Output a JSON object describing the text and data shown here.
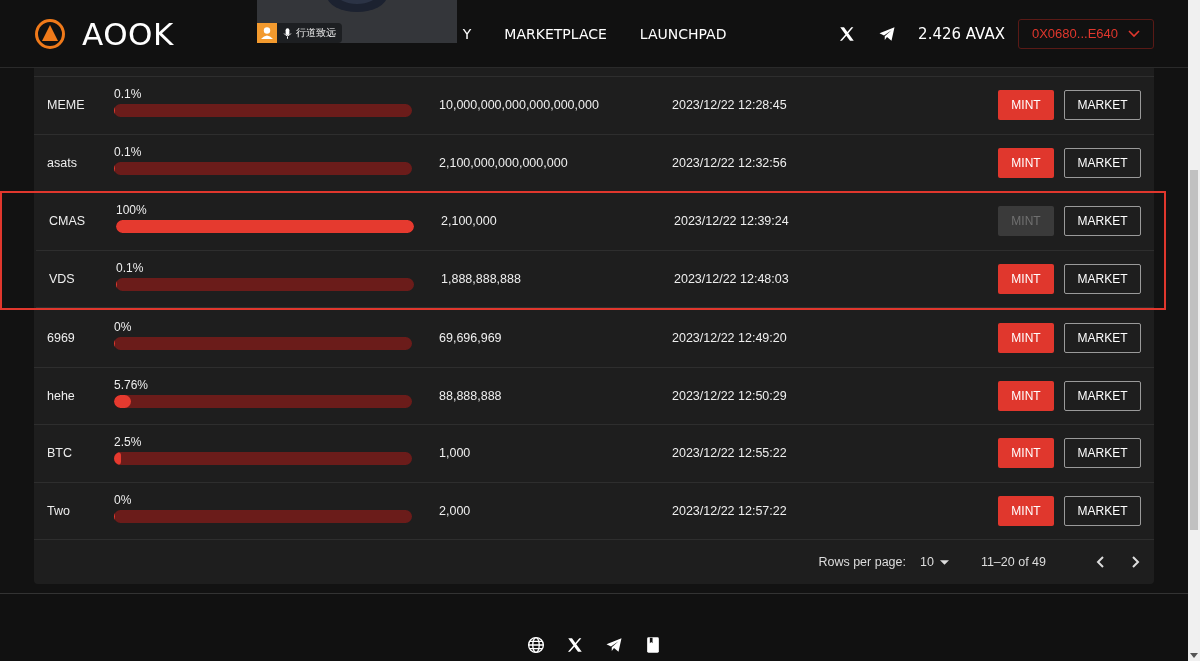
{
  "header": {
    "logo": "AOOK",
    "nav": [
      {
        "label": "Y"
      },
      {
        "label": "MARKETPLACE"
      },
      {
        "label": "LAUNCHPAD"
      }
    ],
    "balance": "2.426 AVAX",
    "wallet": "0X0680...E640"
  },
  "call_overlay": {
    "name": "行道致远"
  },
  "table": {
    "rows": [
      {
        "name": "MEME",
        "progress": "0.1%",
        "level": 0.001,
        "supply": "10,000,000,000,000,000,000",
        "time": "2023/12/22 12:28:45",
        "mint": "MINT",
        "mint_disabled": false,
        "market": "MARKET",
        "highlighted": false
      },
      {
        "name": "asats",
        "progress": "0.1%",
        "level": 0.001,
        "supply": "2,100,000,000,000,000",
        "time": "2023/12/22 12:32:56",
        "mint": "MINT",
        "mint_disabled": false,
        "market": "MARKET",
        "highlighted": false
      },
      {
        "name": "CMAS",
        "progress": "100%",
        "level": 1,
        "supply": "2,100,000",
        "time": "2023/12/22 12:39:24",
        "mint": "MINT",
        "mint_disabled": true,
        "market": "MARKET",
        "highlighted": true
      },
      {
        "name": "VDS",
        "progress": "0.1%",
        "level": 0.001,
        "supply": "1,888,888,888",
        "time": "2023/12/22 12:48:03",
        "mint": "MINT",
        "mint_disabled": false,
        "market": "MARKET",
        "highlighted": true
      },
      {
        "name": "6969",
        "progress": "0%",
        "level": 0,
        "supply": "69,696,969",
        "time": "2023/12/22 12:49:20",
        "mint": "MINT",
        "mint_disabled": false,
        "market": "MARKET",
        "highlighted": false
      },
      {
        "name": "hehe",
        "progress": "5.76%",
        "level": 0.0576,
        "supply": "88,888,888",
        "time": "2023/12/22 12:50:29",
        "mint": "MINT",
        "mint_disabled": false,
        "market": "MARKET",
        "highlighted": false
      },
      {
        "name": "BTC",
        "progress": "2.5%",
        "level": 0.025,
        "supply": "1,000",
        "time": "2023/12/22 12:55:22",
        "mint": "MINT",
        "mint_disabled": false,
        "market": "MARKET",
        "highlighted": false
      },
      {
        "name": "Two",
        "progress": "0%",
        "level": 0,
        "supply": "2,000",
        "time": "2023/12/22 12:57:22",
        "mint": "MINT",
        "mint_disabled": false,
        "market": "MARKET",
        "highlighted": false
      }
    ],
    "pagination": {
      "rows_per_page_label": "Rows per page:",
      "rows_per_page": "10",
      "range": "11–20 of 49"
    }
  }
}
